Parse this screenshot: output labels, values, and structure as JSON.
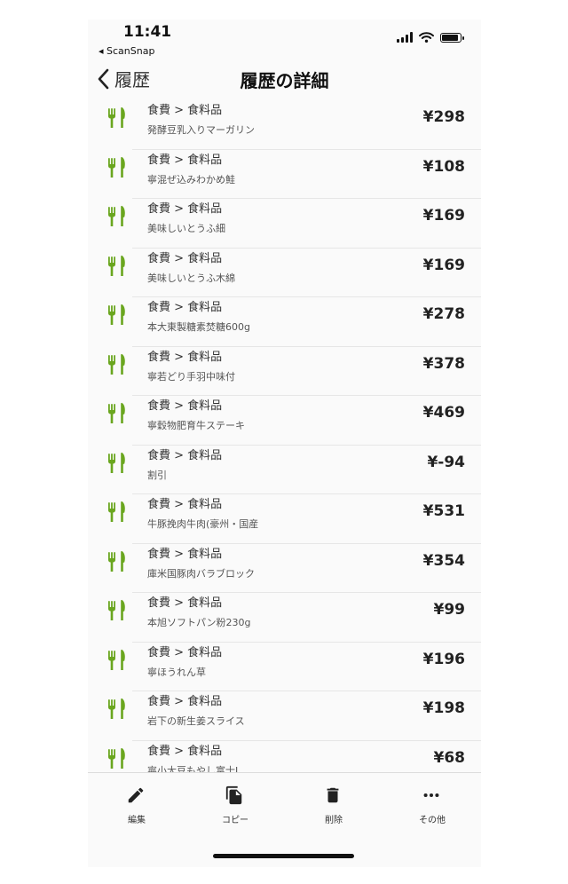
{
  "status_bar": {
    "time": "11:41",
    "back_app": "◂ ScanSnap"
  },
  "nav": {
    "back_label": "履歴",
    "title": "履歴の詳細"
  },
  "colors": {
    "accent": "#6aa61f",
    "text": "#222222"
  },
  "row_icon": "fork-knife-icon",
  "items": [
    {
      "category": "食費 > 食料品",
      "name": "発酵豆乳入りマーガリン",
      "price": "¥298"
    },
    {
      "category": "食費 > 食料品",
      "name": "寧混ぜ込みわかめ鮭",
      "price": "¥108"
    },
    {
      "category": "食費 > 食料品",
      "name": "美味しいとうふ細",
      "price": "¥169"
    },
    {
      "category": "食費 > 食料品",
      "name": "美味しいとうふ木綿",
      "price": "¥169"
    },
    {
      "category": "食費 > 食料品",
      "name": "本大東製糖素焚糖600g",
      "price": "¥278"
    },
    {
      "category": "食費 > 食料品",
      "name": "寧若どり手羽中味付",
      "price": "¥378"
    },
    {
      "category": "食費 > 食料品",
      "name": "寧穀物肥育牛ステーキ",
      "price": "¥469"
    },
    {
      "category": "食費 > 食料品",
      "name": "割引",
      "price": "¥-94"
    },
    {
      "category": "食費 > 食料品",
      "name": "牛豚挽肉牛肉(豪州・国産",
      "price": "¥531"
    },
    {
      "category": "食費 > 食料品",
      "name": "庫米国豚肉バラブロック",
      "price": "¥354"
    },
    {
      "category": "食費 > 食料品",
      "name": "本旭ソフトパン粉230g",
      "price": "¥99"
    },
    {
      "category": "食費 > 食料品",
      "name": "寧ほうれん草",
      "price": "¥196"
    },
    {
      "category": "食費 > 食料品",
      "name": "岩下の新生姜スライス",
      "price": "¥198"
    },
    {
      "category": "食費 > 食料品",
      "name": "寧小大豆もやし富士J",
      "price": "¥68"
    }
  ],
  "toolbar": {
    "edit": "編集",
    "copy": "コピー",
    "delete": "削除",
    "more": "その他"
  }
}
